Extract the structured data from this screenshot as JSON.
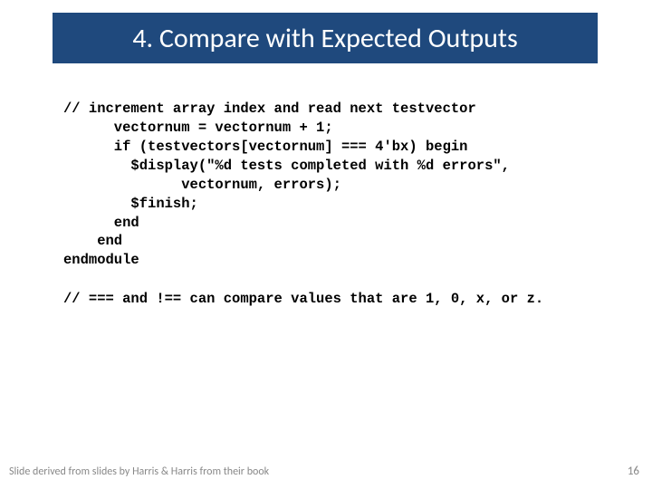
{
  "title": "4. Compare with Expected Outputs",
  "code": "// increment array index and read next testvector\n      vectornum = vectornum + 1;\n      if (testvectors[vectornum] === 4'bx) begin\n        $display(\"%d tests completed with %d errors\",\n              vectornum, errors);\n        $finish;\n      end\n    end\nendmodule",
  "note": "// === and !== can compare values that are 1, 0, x, or z.",
  "footer_left": "Slide derived from slides by Harris & Harris from their book",
  "footer_right": "16"
}
